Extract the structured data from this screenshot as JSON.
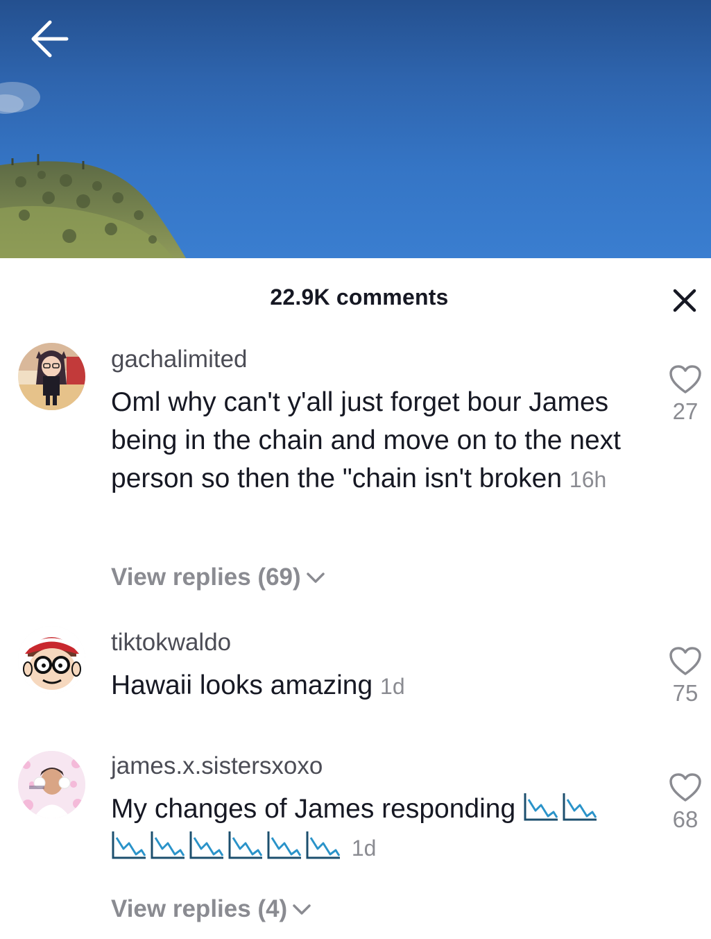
{
  "header": {
    "back_icon": "arrow-left-icon"
  },
  "comments_sheet": {
    "title": "22.9K comments",
    "close_icon": "close-icon",
    "comments": [
      {
        "username": "gachalimited",
        "text": "Oml why can't y'all just forget bour James being in the chain and move on to the next person so then the \"chain isn't broken",
        "time": "16h",
        "likes": "27",
        "replies_label": "View replies (69)"
      },
      {
        "username": "tiktokwaldo",
        "text": "Hawaii looks amazing",
        "time": "1d",
        "likes": "75"
      },
      {
        "username": "james.x.sistersxoxo",
        "text": "My changes of James responding",
        "emoji": "chart-decreasing-icon",
        "emoji_count": 8,
        "time": "1d",
        "likes": "68",
        "replies_label": "View replies (4)"
      }
    ]
  },
  "colors": {
    "sky": "#3575c5",
    "text_primary": "#161823",
    "text_secondary": "#8a8b91",
    "username": "#4b4c55"
  }
}
